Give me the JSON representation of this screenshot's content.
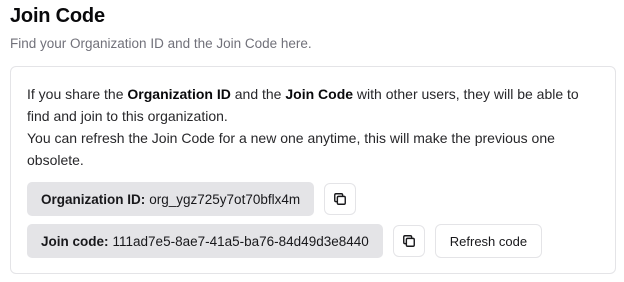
{
  "header": {
    "title": "Join Code",
    "subtitle": "Find your Organization ID and the Join Code here."
  },
  "info": {
    "p1_a": "If you share the ",
    "p1_org": "Organization ID",
    "p1_b": " and the ",
    "p1_join": "Join Code",
    "p1_c": " with other users, they will be able to find and join to this organization.",
    "p2": "You can refresh the Join Code for a new one anytime, this will make the previous one obsolete."
  },
  "org": {
    "label": "Organization ID:",
    "value": "org_ygz725y7ot70bflx4m",
    "copy_icon": "copy-icon"
  },
  "join": {
    "label": "Join code:",
    "value": "111ad7e5-8ae7-41a5-ba76-84d49d3e8440",
    "copy_icon": "copy-icon",
    "refresh_label": "Refresh code"
  }
}
